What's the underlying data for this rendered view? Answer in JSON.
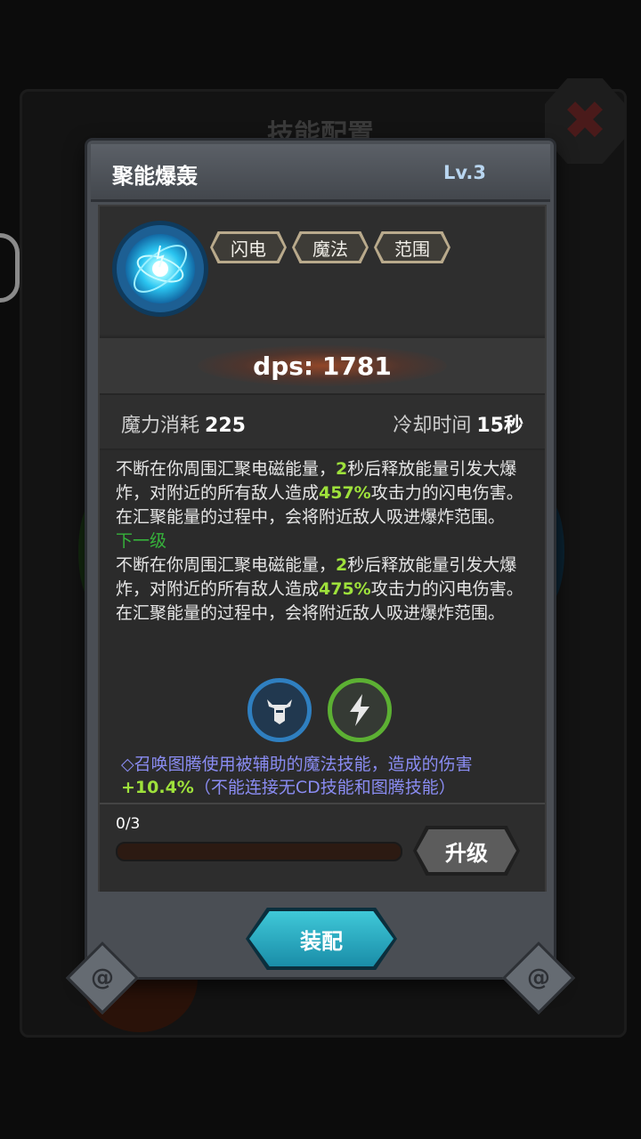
{
  "background": {
    "title": "技能配置"
  },
  "skill": {
    "name": "聚能爆轰",
    "level": "Lv.3",
    "icon": "lightning-orb-icon",
    "tags": [
      "闪电",
      "魔法",
      "范围"
    ],
    "dps": "dps: 1781",
    "mana_label": "魔力消耗",
    "mana_value": "225",
    "cooldown_label": "冷却时间",
    "cooldown_value": "15秒"
  },
  "description": {
    "current_a": "不断在你周围汇聚电磁能量，",
    "current_b": "2",
    "current_c": "秒后释放能量引发大爆炸，对附近的所有敌人造成",
    "current_d": "457%",
    "current_e": "攻击力的闪电伤害。在汇聚能量的过程中，会将附近敌人吸进爆炸范围。",
    "next_level_label": "下一级",
    "next_a": "不断在你周围汇聚电磁能量，",
    "next_b": "2",
    "next_c": "秒后释放能量引发大爆炸，对附近的所有敌人造成",
    "next_d": "475%",
    "next_e": "攻击力的闪电伤害。在汇聚能量的过程中，会将附近敌人吸进爆炸范围。"
  },
  "aux_icons": [
    "totem-icon",
    "lightning-icon"
  ],
  "assist": {
    "text_a": "◇召唤图腾使用被辅助的魔法技能，造成的伤害",
    "text_b": "+10.4%",
    "text_c": "（不能连接无CD技能和图腾技能）"
  },
  "upgrade": {
    "progress_label": "0/3",
    "progress_fraction": 0,
    "button_label": "升级"
  },
  "equip_button_label": "装配",
  "colors": {
    "highlight_green": "#9ee13b",
    "next_level_green": "#36b23b",
    "assist_purple": "#8a8cf2",
    "equip_cyan": "#3fc8d8"
  }
}
